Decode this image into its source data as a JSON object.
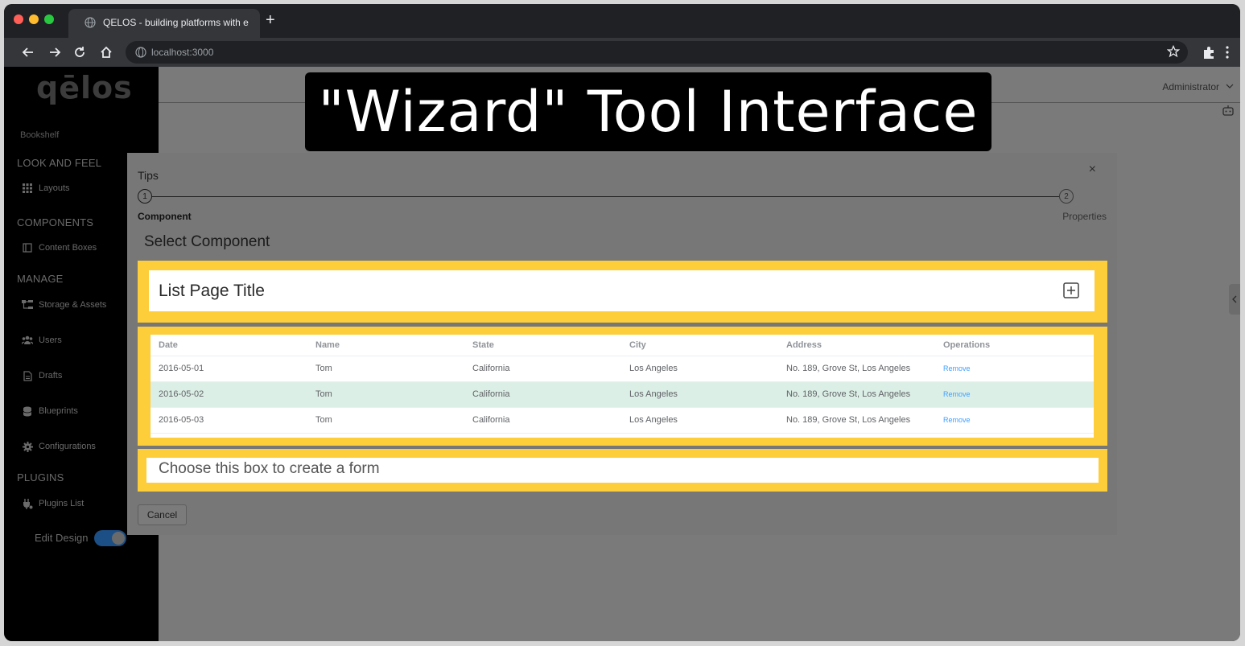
{
  "browser": {
    "tab_title": "QELOS - building platforms with e",
    "new_tab": "+",
    "url": "localhost:3000"
  },
  "sidebar": {
    "logo": "qēlos",
    "bookshelf": "Bookshelf",
    "sections": {
      "look_and_feel": "LOOK AND FEEL",
      "components": "COMPONENTS",
      "manage": "MANAGE",
      "plugins": "PLUGINS"
    },
    "items": {
      "layouts": "Layouts",
      "content_boxes": "Content Boxes",
      "storage": "Storage & Assets",
      "users": "Users",
      "drafts": "Drafts",
      "blueprints": "Blueprints",
      "configurations": "Configurations",
      "plugins_list": "Plugins List"
    },
    "edit_design": "Edit Design",
    "edit_design_on": true
  },
  "header": {
    "user": "Administrator"
  },
  "banner": {
    "text": "\"Wizard\" Tool Interface"
  },
  "dialog": {
    "title": "Tips",
    "close": "×",
    "steps": [
      {
        "number": "1",
        "label": "Component",
        "active": true
      },
      {
        "number": "2",
        "label": "Properties",
        "active": false
      }
    ],
    "heading": "Select Component",
    "option_list_title": "List Page Title",
    "table": {
      "columns": [
        "Date",
        "Name",
        "State",
        "City",
        "Address",
        "Operations"
      ],
      "rows": [
        {
          "date": "2016-05-01",
          "name": "Tom",
          "state": "California",
          "city": "Los Angeles",
          "address": "No. 189, Grove St, Los Angeles",
          "op": "Remove"
        },
        {
          "date": "2016-05-02",
          "name": "Tom",
          "state": "California",
          "city": "Los Angeles",
          "address": "No. 189, Grove St, Los Angeles",
          "op": "Remove"
        },
        {
          "date": "2016-05-03",
          "name": "Tom",
          "state": "California",
          "city": "Los Angeles",
          "address": "No. 189, Grove St, Los Angeles",
          "op": "Remove"
        }
      ]
    },
    "option_form": "Choose this box to create a form",
    "cancel": "Cancel"
  },
  "colors": {
    "highlight_box": "#fecd3a",
    "accent_link": "#409eff",
    "row_highlight": "#dcefe6"
  }
}
